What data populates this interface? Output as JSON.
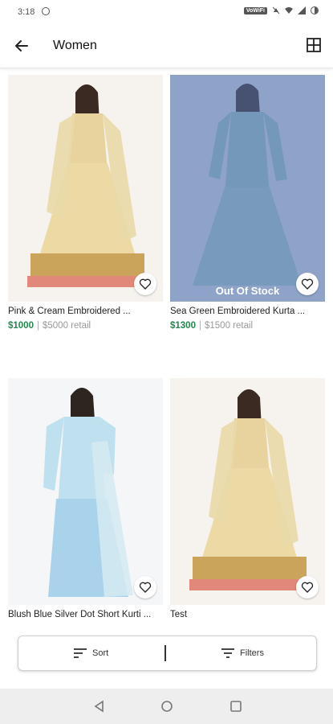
{
  "status_bar": {
    "time": "3:18",
    "chip": "VoWiFi"
  },
  "app_bar": {
    "title": "Women",
    "back_icon": "arrow-left-icon",
    "view_icon": "grid-view-icon"
  },
  "products": [
    {
      "name": "Pink & Cream Embroidered ...",
      "price": "$1000",
      "retail": "$5000 retail",
      "out_of_stock": false
    },
    {
      "name": "Sea Green Embroidered Kurta ...",
      "price": "$1300",
      "retail": "$1500 retail",
      "out_of_stock": true,
      "badge": "Out Of Stock"
    },
    {
      "name": "Blush Blue Silver Dot Short Kurti ...",
      "price": "",
      "retail": "",
      "out_of_stock": false
    },
    {
      "name": "Test",
      "price": "",
      "retail": "",
      "out_of_stock": false
    }
  ],
  "price_separator": "|",
  "sort_bar": {
    "sort_label": "Sort",
    "filters_label": "Filters"
  },
  "colors": {
    "price_green": "#1f8a4c",
    "out_of_stock_overlay": "#506eaa"
  }
}
